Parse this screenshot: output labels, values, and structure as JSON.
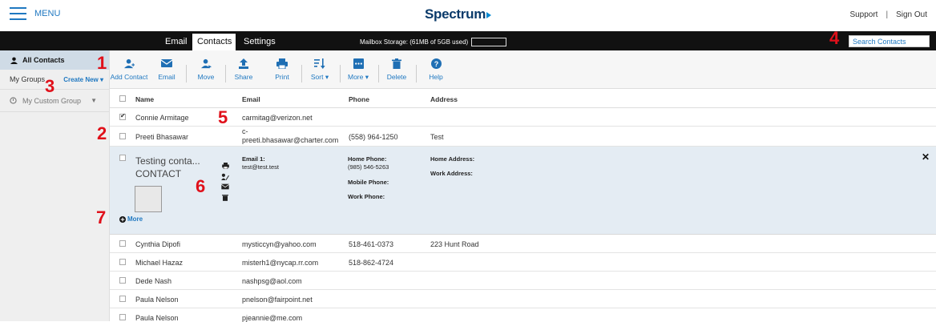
{
  "header": {
    "menu_label": "MENU",
    "logo": "Spectrum",
    "support": "Support",
    "separator": "|",
    "signout": "Sign Out"
  },
  "nav": {
    "tabs": [
      {
        "label": "Email"
      },
      {
        "label": "Contacts"
      },
      {
        "label": "Settings"
      }
    ],
    "storage": "Mailbox Storage: (61MB of 5GB used)",
    "search_placeholder": "Search Contacts"
  },
  "sidebar": {
    "all_contacts": "All Contacts",
    "my_groups": "My Groups",
    "create_new": "Create New ▾",
    "custom_group": "My Custom Group"
  },
  "toolbar": {
    "items": [
      {
        "label": "Add Contact",
        "icon": "add-contact-icon"
      },
      {
        "label": "Email",
        "icon": "email-icon"
      },
      {
        "label": "Move",
        "icon": "move-icon"
      },
      {
        "label": "Share",
        "icon": "share-icon"
      },
      {
        "label": "Print",
        "icon": "print-icon"
      },
      {
        "label": "Sort ▾",
        "icon": "sort-icon"
      },
      {
        "label": "More ▾",
        "icon": "more-icon"
      },
      {
        "label": "Delete",
        "icon": "delete-icon"
      },
      {
        "label": "Help",
        "icon": "help-icon"
      }
    ]
  },
  "table": {
    "headers": {
      "name": "Name",
      "email": "Email",
      "phone": "Phone",
      "address": "Address"
    },
    "rows": [
      {
        "name": "Connie Armitage",
        "email": "carmitag@verizon.net",
        "phone": "",
        "address": "",
        "checked": true
      },
      {
        "name": "Preeti Bhasawar",
        "email": "c-preeti.bhasawar@charter.com",
        "phone": "(558) 964-1250",
        "address": "Test",
        "checked": false
      },
      {
        "name": "Cynthia Dipofi",
        "email": "mysticcyn@yahoo.com",
        "phone": "518-461-0373",
        "address": "223 Hunt Road",
        "checked": false
      },
      {
        "name": "Michael Hazaz",
        "email": "misterh1@nycap.rr.com",
        "phone": "518-862-4724",
        "address": "",
        "checked": false
      },
      {
        "name": "Dede Nash",
        "email": "nashpsg@aol.com",
        "phone": "",
        "address": "",
        "checked": false
      },
      {
        "name": "Paula  Nelson",
        "email": "pnelson@fairpoint.net",
        "phone": "",
        "address": "",
        "checked": false
      },
      {
        "name": "Paula  Nelson",
        "email": "pjeannie@me.com",
        "phone": "",
        "address": "",
        "checked": false
      }
    ]
  },
  "detail": {
    "name_line1": "Testing conta...",
    "name_line2": "CONTACT",
    "more": "More",
    "email_label": "Email 1:",
    "email_value": "test@test.test",
    "home_phone_label": "Home Phone:",
    "home_phone_value": "(985) 546-5263",
    "mobile_phone_label": "Mobile Phone:",
    "work_phone_label": "Work Phone:",
    "home_address_label": "Home Address:",
    "work_address_label": "Work Address:",
    "close": "✕"
  },
  "annotations": [
    "1",
    "2",
    "3",
    "4",
    "5",
    "6",
    "7"
  ],
  "colors": {
    "accent": "#1f78c1",
    "navbar": "#111111",
    "annotation": "#e0101a",
    "selected": "#e4ecf3"
  }
}
